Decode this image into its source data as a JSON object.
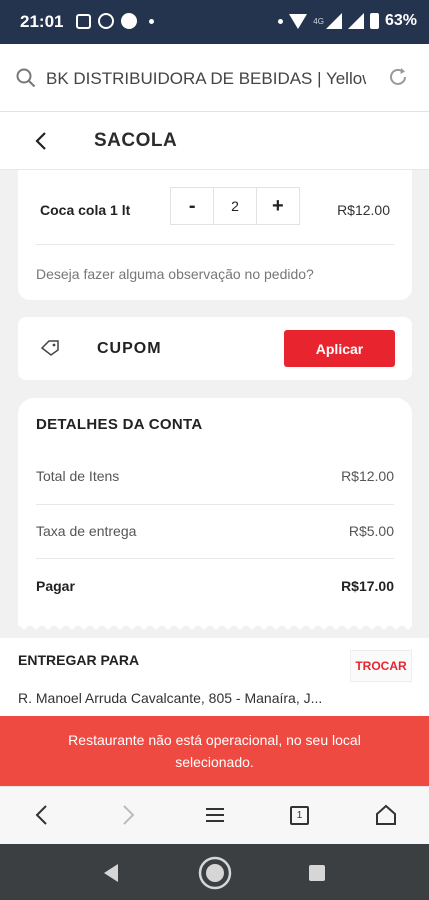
{
  "status_bar": {
    "time": "21:01",
    "network": "4G",
    "battery": "63%"
  },
  "browser": {
    "url": "BK DISTRIBUIDORA DE BEBIDAS | Yellows Menu"
  },
  "page": {
    "title": "SACOLA"
  },
  "cart": {
    "item_name": "Coca cola 1 lt",
    "minus": "-",
    "quantity": "2",
    "plus": "+",
    "item_price": "R$12.00",
    "observation_placeholder": "Deseja fazer alguma observação no pedido?"
  },
  "coupon": {
    "label": "CUPOM",
    "apply_label": "Aplicar"
  },
  "details": {
    "title": "DETALHES DA CONTA",
    "rows": [
      {
        "label": "Total de Itens",
        "value": "R$12.00"
      },
      {
        "label": "Taxa de entrega",
        "value": "R$5.00"
      },
      {
        "label": "Pagar",
        "value": "R$17.00"
      }
    ]
  },
  "delivery": {
    "label": "ENTREGAR PARA",
    "change_label": "TROCAR",
    "address": "R. Manoel Arruda Cavalcante, 805 - Manaíra, J..."
  },
  "alert": {
    "message": "Restaurante não está operacional, no seu local selecionado."
  },
  "browser_nav": {
    "tab_count": "1"
  },
  "colors": {
    "accent": "#e8252e",
    "alert": "#ef4a42",
    "status_bar": "#24344f",
    "system_nav": "#3c3f41"
  }
}
